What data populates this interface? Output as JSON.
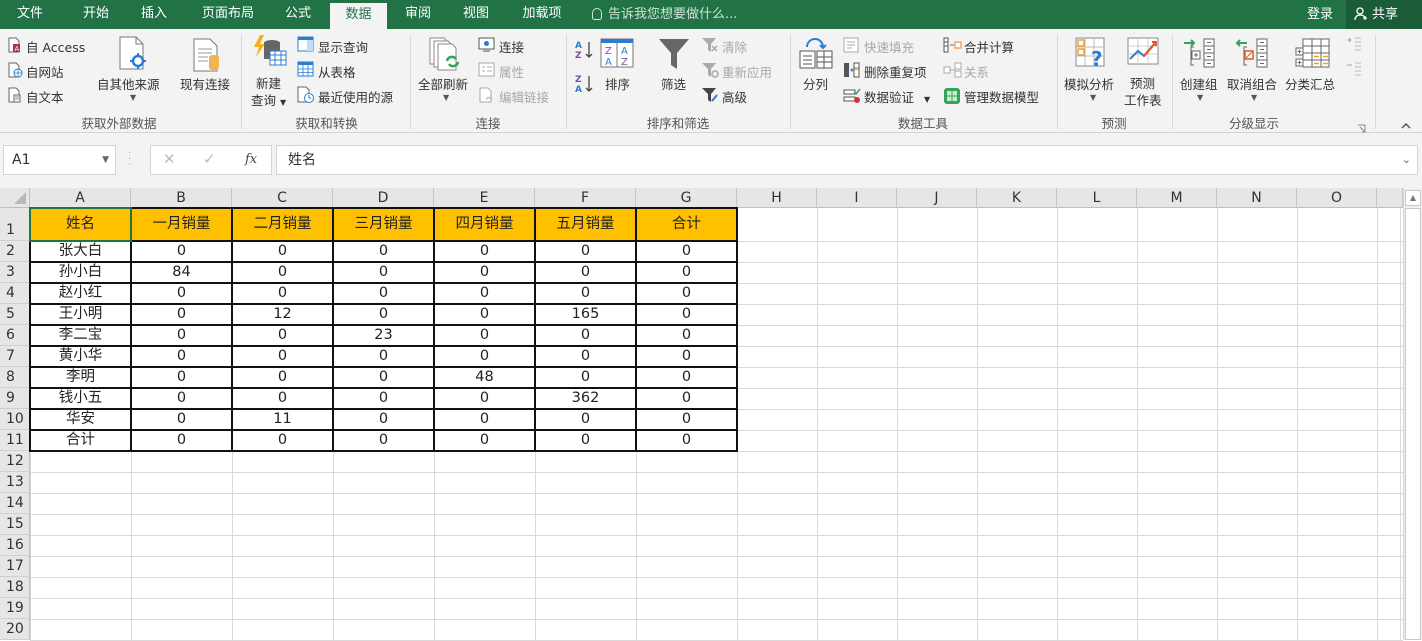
{
  "tabs": [
    {
      "label": "文件",
      "active": false
    },
    {
      "label": "开始",
      "active": false
    },
    {
      "label": "插入",
      "active": false
    },
    {
      "label": "页面布局",
      "active": false
    },
    {
      "label": "公式",
      "active": false
    },
    {
      "label": "数据",
      "active": true
    },
    {
      "label": "审阅",
      "active": false
    },
    {
      "label": "视图",
      "active": false
    },
    {
      "label": "加载项",
      "active": false
    }
  ],
  "tell_me": "告诉我您想要做什么...",
  "login": "登录",
  "share": "共享",
  "ribbon": {
    "get_external": {
      "group_label": "获取外部数据",
      "from_access": "自 Access",
      "from_web": "自网站",
      "from_text": "自文本",
      "from_other": "自其他来源",
      "existing_conn": "现有连接"
    },
    "get_transform": {
      "group_label": "获取和转换",
      "new_query_1": "新建",
      "new_query_2": "查询",
      "show_queries": "显示查询",
      "from_table": "从表格",
      "recent_sources": "最近使用的源"
    },
    "connections": {
      "group_label": "连接",
      "refresh_all": "全部刷新",
      "connections": "连接",
      "properties": "属性",
      "edit_links": "编辑链接"
    },
    "sort_filter": {
      "group_label": "排序和筛选",
      "sort": "排序",
      "filter": "筛选",
      "clear": "清除",
      "reapply": "重新应用",
      "advanced": "高级"
    },
    "data_tools": {
      "group_label": "数据工具",
      "text_to_columns": "分列",
      "flash_fill": "快速填充",
      "remove_duplicates": "删除重复项",
      "data_validation": "数据验证",
      "consolidate": "合并计算",
      "relationships": "关系",
      "manage_model": "管理数据模型"
    },
    "forecast": {
      "group_label": "预测",
      "what_if": "模拟分析",
      "forecast_sheet_1": "预测",
      "forecast_sheet_2": "工作表"
    },
    "outline": {
      "group_label": "分级显示",
      "group": "创建组",
      "ungroup": "取消组合",
      "subtotal": "分类汇总"
    }
  },
  "formula_bar": {
    "name_box": "A1",
    "formula": "姓名"
  },
  "columns": [
    "A",
    "B",
    "C",
    "D",
    "E",
    "F",
    "G",
    "H",
    "I",
    "J",
    "K",
    "L",
    "M",
    "N",
    "O"
  ],
  "rows": [
    "1",
    "2",
    "3",
    "4",
    "5",
    "6",
    "7",
    "8",
    "9",
    "10",
    "11",
    "12",
    "13",
    "14",
    "15",
    "16",
    "17",
    "18",
    "19",
    "20"
  ],
  "table": {
    "header": [
      "姓名",
      "一月销量",
      "二月销量",
      "三月销量",
      "四月销量",
      "五月销量",
      "合计"
    ],
    "header_color": "#ffc000",
    "rows": [
      [
        "张大白",
        "0",
        "0",
        "0",
        "0",
        "0",
        "0"
      ],
      [
        "孙小白",
        "84",
        "0",
        "0",
        "0",
        "0",
        "0"
      ],
      [
        "赵小红",
        "0",
        "0",
        "0",
        "0",
        "0",
        "0"
      ],
      [
        "王小明",
        "0",
        "12",
        "0",
        "0",
        "165",
        "0"
      ],
      [
        "李二宝",
        "0",
        "0",
        "23",
        "0",
        "0",
        "0"
      ],
      [
        "黄小华",
        "0",
        "0",
        "0",
        "0",
        "0",
        "0"
      ],
      [
        "李明",
        "0",
        "0",
        "0",
        "48",
        "0",
        "0"
      ],
      [
        "钱小五",
        "0",
        "0",
        "0",
        "0",
        "362",
        "0"
      ],
      [
        "华安",
        "0",
        "11",
        "0",
        "0",
        "0",
        "0"
      ],
      [
        "合计",
        "0",
        "0",
        "0",
        "0",
        "0",
        "0"
      ]
    ]
  },
  "selected_cell": "A1",
  "accent_color": "#217346"
}
